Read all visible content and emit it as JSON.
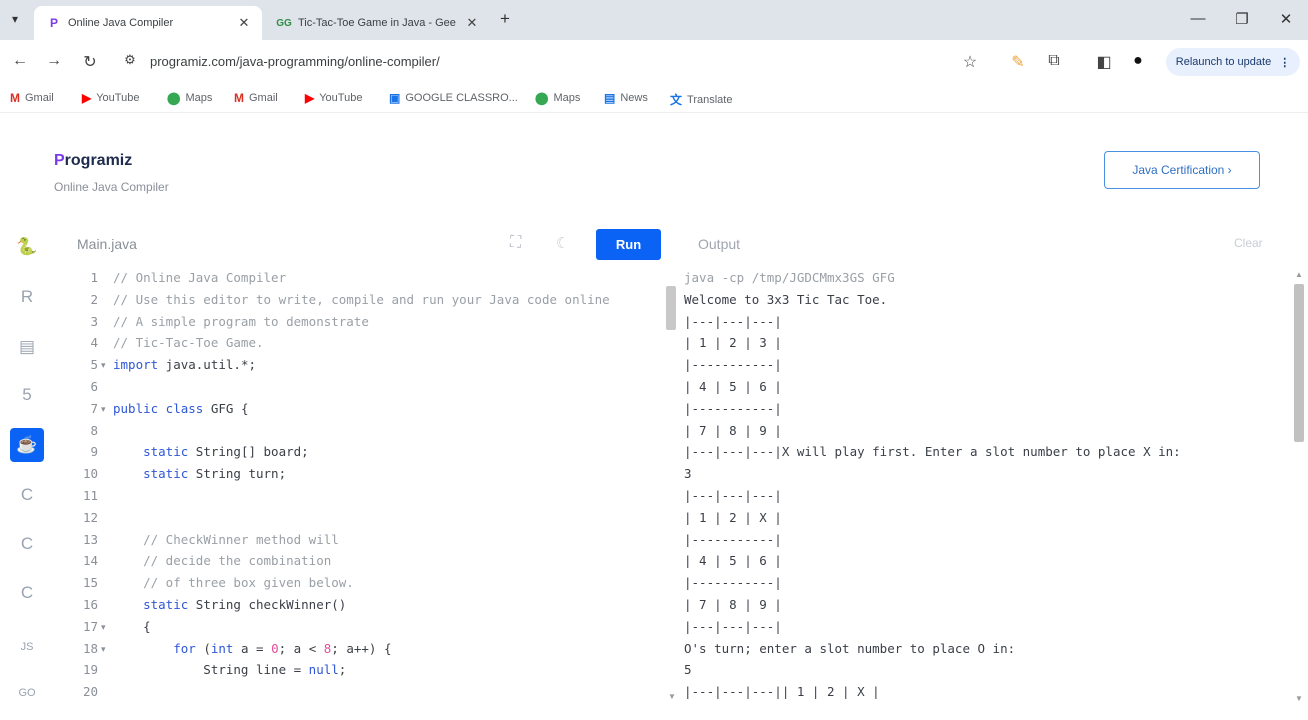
{
  "tabs": [
    {
      "label": "Online Java Compiler",
      "icon": "programiz-favicon",
      "active": true
    },
    {
      "label": "Tic-Tac-Toe Game in Java - Gee",
      "icon": "gfg-favicon",
      "active": false
    }
  ],
  "toolbar": {
    "url": "programiz.com/java-programming/online-compiler/",
    "relaunch": "Relaunch to update"
  },
  "bookmarks": [
    {
      "label": "Gmail",
      "icon": "gmail-icon"
    },
    {
      "label": "YouTube",
      "icon": "youtube-icon"
    },
    {
      "label": "Maps",
      "icon": "maps-icon"
    },
    {
      "label": "Gmail",
      "icon": "gmail-icon"
    },
    {
      "label": "YouTube",
      "icon": "youtube-icon"
    },
    {
      "label": "GOOGLE CLASSRO...",
      "icon": "classroom-icon"
    },
    {
      "label": "Maps",
      "icon": "maps-icon"
    },
    {
      "label": "News",
      "icon": "news-icon"
    },
    {
      "label": "Translate",
      "icon": "translate-icon"
    }
  ],
  "site": {
    "logo_p": "P",
    "logo_rest": "rogramiz",
    "subtitle": "Online Java Compiler",
    "cert_button": "Java Certification ›"
  },
  "editor": {
    "filename": "Main.java",
    "run": "Run",
    "output_label": "Output",
    "clear": "Clear",
    "line_numbers": [
      "1",
      "2",
      "3",
      "4",
      "5",
      "6",
      "7",
      "8",
      "9",
      "10",
      "11",
      "12",
      "13",
      "14",
      "15",
      "16",
      "17",
      "18",
      "19",
      "20"
    ],
    "folds": [
      "",
      "",
      "",
      "",
      "▾",
      "",
      "▾",
      "",
      "",
      "",
      "",
      "",
      "",
      "",
      "",
      "",
      "▾",
      "▾",
      "",
      ""
    ]
  },
  "code_lines": [
    [
      {
        "c": "cm",
        "t": "// Online Java Compiler"
      }
    ],
    [
      {
        "c": "cm",
        "t": "// Use this editor to write, compile and run your Java code online"
      }
    ],
    [
      {
        "c": "cm",
        "t": "// A simple program to demonstrate"
      }
    ],
    [
      {
        "c": "cm",
        "t": "// Tic-Tac-Toe Game."
      }
    ],
    [
      {
        "c": "kw",
        "t": "import"
      },
      {
        "c": "tx",
        "t": " java.util.*;"
      }
    ],
    [],
    [
      {
        "c": "kw",
        "t": "public class"
      },
      {
        "c": "tx",
        "t": " GFG {"
      }
    ],
    [],
    [
      {
        "c": "tx",
        "t": "    "
      },
      {
        "c": "kw",
        "t": "static"
      },
      {
        "c": "tx",
        "t": " String[] board;"
      }
    ],
    [
      {
        "c": "tx",
        "t": "    "
      },
      {
        "c": "kw",
        "t": "static"
      },
      {
        "c": "tx",
        "t": " String turn;"
      }
    ],
    [],
    [],
    [
      {
        "c": "tx",
        "t": "    "
      },
      {
        "c": "cm",
        "t": "// CheckWinner method will"
      }
    ],
    [
      {
        "c": "tx",
        "t": "    "
      },
      {
        "c": "cm",
        "t": "// decide the combination"
      }
    ],
    [
      {
        "c": "tx",
        "t": "    "
      },
      {
        "c": "cm",
        "t": "// of three box given below."
      }
    ],
    [
      {
        "c": "tx",
        "t": "    "
      },
      {
        "c": "kw",
        "t": "static"
      },
      {
        "c": "tx",
        "t": " String checkWinner()"
      }
    ],
    [
      {
        "c": "tx",
        "t": "    {"
      }
    ],
    [
      {
        "c": "tx",
        "t": "        "
      },
      {
        "c": "kw",
        "t": "for"
      },
      {
        "c": "tx",
        "t": " ("
      },
      {
        "c": "kw",
        "t": "int"
      },
      {
        "c": "tx",
        "t": " a = "
      },
      {
        "c": "nm",
        "t": "0"
      },
      {
        "c": "tx",
        "t": "; a < "
      },
      {
        "c": "nm",
        "t": "8"
      },
      {
        "c": "tx",
        "t": "; a++) {"
      }
    ],
    [
      {
        "c": "tx",
        "t": "            String line = "
      },
      {
        "c": "kw",
        "t": "null"
      },
      {
        "c": "tx",
        "t": ";"
      }
    ],
    []
  ],
  "output_lines": [
    "java -cp /tmp/JGDCMmx3GS GFG",
    "Welcome to 3x3 Tic Tac Toe.",
    "|---|---|---|",
    "| 1 | 2 | 3 |",
    "|-----------|",
    "| 4 | 5 | 6 |",
    "|-----------|",
    "| 7 | 8 | 9 |",
    "|---|---|---|X will play first. Enter a slot number to place X in:",
    "3",
    "|---|---|---|",
    "| 1 | 2 | X |",
    "|-----------|",
    "| 4 | 5 | 6 |",
    "|-----------|",
    "| 7 | 8 | 9 |",
    "|---|---|---|",
    "O's turn; enter a slot number to place O in:",
    "5",
    "|---|---|---|| 1 | 2 | X |"
  ],
  "rail_icons": [
    "python-icon",
    "r-icon",
    "sql-icon",
    "html5-icon",
    "java-icon",
    "c-icon",
    "cpp-icon",
    "csharp-icon",
    "javascript-icon",
    "go-icon"
  ],
  "colors": {
    "accent": "#0b63f6",
    "comment": "#9aa0a6",
    "keyword": "#2f56d6",
    "number": "#e0509a"
  }
}
